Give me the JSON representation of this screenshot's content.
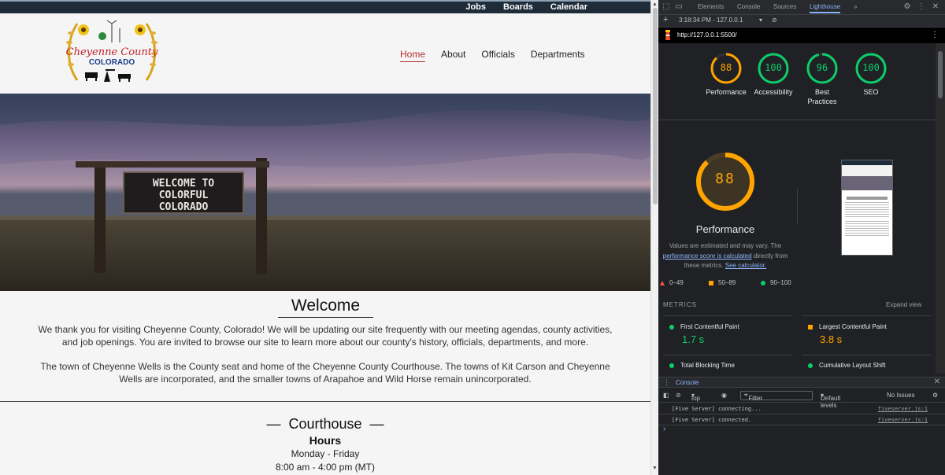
{
  "site": {
    "topbar": {
      "links": [
        "Jobs",
        "Boards",
        "Calendar"
      ]
    },
    "logo": {
      "line1": "Cheyenne County",
      "line2": "COLORADO"
    },
    "nav": {
      "items": [
        "Home",
        "About",
        "Officials",
        "Departments"
      ],
      "active": "Home"
    },
    "hero": {
      "sign_line1": "WELCOME TO",
      "sign_line2": "COLORFUL",
      "sign_line3": "COLORADO"
    },
    "welcome": {
      "title": "Welcome",
      "paragraph1": "We thank you for visiting Cheyenne County, Colorado! We will be updating our site frequently with our meeting agendas, county activities, and job openings. You are invited to browse our site to learn more about our county's history, officials, departments, and more.",
      "paragraph2": "The town of Cheyenne Wells is the County seat and home of the Cheyenne County Courthouse. The towns of Kit Carson and Cheyenne Wells are incorporated, and the smaller towns of Arapahoe and Wild Horse remain unincorporated."
    },
    "courthouse": {
      "dash": "—",
      "title": "Courthouse",
      "hours_title": "Hours",
      "days": "Monday - Friday",
      "time": "8:00 am - 4:00 pm (MT)"
    }
  },
  "devtools": {
    "tabs": [
      "Elements",
      "Console",
      "Sources",
      "Lighthouse"
    ],
    "active_tab": "Lighthouse",
    "more_tabs": "»",
    "report_time": "3:18:34 PM - 127.0.0.1",
    "url": "http://127.0.0.1:5500/",
    "scores": [
      {
        "name": "Performance",
        "value": "88",
        "color": "#ffa400",
        "fraction": 0.88
      },
      {
        "name": "Accessibility",
        "value": "100",
        "color": "#0cce6b",
        "fraction": 1.0
      },
      {
        "name": "Best Practices",
        "value": "96",
        "color": "#0cce6b",
        "fraction": 0.96
      },
      {
        "name": "SEO",
        "value": "100",
        "color": "#0cce6b",
        "fraction": 1.0
      }
    ],
    "performance": {
      "score": "88",
      "title": "Performance",
      "note_prefix": "Values are estimated and may vary. The ",
      "note_link": "performance score is calculated",
      "note_middle": " directly from these metrics. ",
      "note_link2": "See calculator."
    },
    "legend": [
      {
        "range": "0–49",
        "color": "#ff4e42"
      },
      {
        "range": "50–89",
        "color": "#ffa400"
      },
      {
        "range": "90–100",
        "color": "#0cce6b"
      }
    ],
    "metrics_heading": "METRICS",
    "expand_view": "Expand view",
    "metrics": [
      {
        "name": "First Contentful Paint",
        "value": "1.7 s",
        "color": "#0cce6b"
      },
      {
        "name": "Largest Contentful Paint",
        "value": "3.8 s",
        "color": "#ffa400"
      },
      {
        "name": "Total Blocking Time",
        "value": "",
        "color": "#0cce6b"
      },
      {
        "name": "Cumulative Layout Shift",
        "value": "",
        "color": "#0cce6b"
      }
    ],
    "console": {
      "tab": "Console",
      "context": "top",
      "filter_placeholder": "Filter",
      "levels": "Default levels",
      "issues": "No Issues",
      "logs": [
        {
          "message": "[Five Server] connecting...",
          "source": "fiveserver.js:1"
        },
        {
          "message": "[Five Server] connected.",
          "source": "fiveserver.js:1"
        }
      ],
      "prompt": "›"
    }
  }
}
